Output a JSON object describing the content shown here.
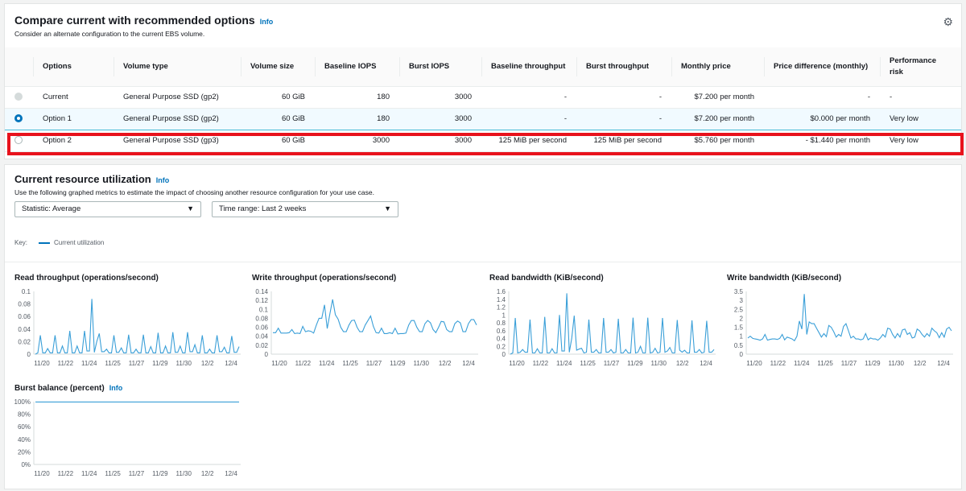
{
  "compare": {
    "title": "Compare current with recommended options",
    "info": "Info",
    "subtitle": "Consider an alternate configuration to the current EBS volume.",
    "settings_icon": "gear-icon",
    "columns": [
      "Options",
      "Volume type",
      "Volume size",
      "Baseline IOPS",
      "Burst IOPS",
      "Baseline throughput",
      "Burst throughput",
      "Monthly price",
      "Price difference (monthly)",
      "Performance risk"
    ],
    "rows": [
      {
        "state": "disabled",
        "option": "Current",
        "volume_type": "General Purpose SSD (gp2)",
        "volume_size": "60 GiB",
        "baseline_iops": "180",
        "burst_iops": "3000",
        "baseline_throughput": "-",
        "burst_throughput": "-",
        "monthly_price": "$7.200 per month",
        "price_difference": "-",
        "performance_risk": "-"
      },
      {
        "state": "selected",
        "option": "Option 1",
        "volume_type": "General Purpose SSD (gp2)",
        "volume_size": "60 GiB",
        "baseline_iops": "180",
        "burst_iops": "3000",
        "baseline_throughput": "-",
        "burst_throughput": "-",
        "monthly_price": "$7.200 per month",
        "price_difference": "$0.000 per month",
        "performance_risk": "Very low"
      },
      {
        "state": "unselected",
        "option": "Option 2",
        "volume_type": "General Purpose SSD (gp3)",
        "volume_size": "60 GiB",
        "baseline_iops": "3000",
        "burst_iops": "3000",
        "baseline_throughput": "125 MiB per second",
        "burst_throughput": "125 MiB per second",
        "monthly_price": "$5.760 per month",
        "price_difference": "- $1.440 per month",
        "performance_risk": "Very low"
      }
    ],
    "highlight_color": "#e8121c"
  },
  "utilization": {
    "title": "Current resource utilization",
    "info": "Info",
    "subtitle": "Use the following graphed metrics to estimate the impact of choosing another resource configuration for your use case.",
    "statistic": "Statistic: Average",
    "time_range": "Time range: Last 2 weeks",
    "key_label": "Key:",
    "legend": "Current utilization",
    "line_color": "#0073bb"
  },
  "chart_data": [
    {
      "type": "line",
      "title": "Read throughput (operations/second)",
      "ylim": [
        0,
        0.1
      ],
      "yticks": [
        "0",
        "0.02",
        "0.04",
        "0.06",
        "0.08",
        "0.1"
      ],
      "xticks": [
        "11/20",
        "11/22",
        "11/24",
        "11/25",
        "11/27",
        "11/29",
        "11/30",
        "12/2",
        "12/4"
      ],
      "series": [
        {
          "values": [
            0,
            0.002,
            0.03,
            0.002,
            0.002,
            0.009,
            0.002,
            0.002,
            0.03,
            0.002,
            0.002,
            0.013,
            0.002,
            0.002,
            0.037,
            0.002,
            0.002,
            0.013,
            0.002,
            0.002,
            0.037,
            0.005,
            0.005,
            0.088,
            0.003,
            0.02,
            0.033,
            0.004,
            0.004,
            0.008,
            0.002,
            0.002,
            0.03,
            0.003,
            0.003,
            0.01,
            0.002,
            0.002,
            0.031,
            0.002,
            0.002,
            0.008,
            0.002,
            0.002,
            0.031,
            0.002,
            0.002,
            0.012,
            0.002,
            0.002,
            0.034,
            0.002,
            0.002,
            0.013,
            0.002,
            0.002,
            0.035,
            0.003,
            0.003,
            0.013,
            0.002,
            0.002,
            0.035,
            0.004,
            0.004,
            0.015,
            0.002,
            0.002,
            0.03,
            0.002,
            0.002,
            0.008,
            0.002,
            0.002,
            0.03,
            0.004,
            0.004,
            0.011,
            0.002,
            0.002,
            0.029,
            0.003,
            0.003,
            0.012
          ]
        }
      ]
    },
    {
      "type": "line",
      "title": "Write throughput (operations/second)",
      "ylim": [
        0,
        0.14
      ],
      "yticks": [
        "0",
        "0.02",
        "0.04",
        "0.06",
        "0.08",
        "0.1",
        "0.12",
        "0.14"
      ],
      "xticks": [
        "11/20",
        "11/22",
        "11/24",
        "11/25",
        "11/27",
        "11/29",
        "11/30",
        "12/2",
        "12/4"
      ],
      "series": [
        {
          "values": [
            0.048,
            0.048,
            0.058,
            0.047,
            0.047,
            0.047,
            0.048,
            0.055,
            0.046,
            0.047,
            0.046,
            0.062,
            0.05,
            0.052,
            0.051,
            0.047,
            0.065,
            0.08,
            0.08,
            0.11,
            0.057,
            0.09,
            0.122,
            0.088,
            0.078,
            0.06,
            0.05,
            0.05,
            0.065,
            0.075,
            0.076,
            0.06,
            0.05,
            0.05,
            0.065,
            0.075,
            0.085,
            0.062,
            0.048,
            0.047,
            0.058,
            0.046,
            0.046,
            0.048,
            0.046,
            0.058,
            0.045,
            0.046,
            0.046,
            0.047,
            0.065,
            0.075,
            0.075,
            0.06,
            0.05,
            0.05,
            0.068,
            0.075,
            0.07,
            0.055,
            0.048,
            0.06,
            0.073,
            0.072,
            0.055,
            0.05,
            0.05,
            0.068,
            0.074,
            0.07,
            0.05,
            0.05,
            0.068,
            0.077,
            0.077,
            0.065
          ]
        }
      ]
    },
    {
      "type": "line",
      "title": "Read bandwidth (KiB/second)",
      "ylim": [
        0,
        1.6
      ],
      "yticks": [
        "0",
        "0.2",
        "0.4",
        "0.6",
        "0.8",
        "1",
        "1.2",
        "1.4",
        "1.6"
      ],
      "xticks": [
        "11/20",
        "11/22",
        "11/24",
        "11/25",
        "11/27",
        "11/29",
        "11/30",
        "12/2",
        "12/4"
      ],
      "series": [
        {
          "values": [
            0,
            0.03,
            0.92,
            0.03,
            0.05,
            0.12,
            0.05,
            0.05,
            0.88,
            0.03,
            0.03,
            0.14,
            0.03,
            0.03,
            0.95,
            0.03,
            0.03,
            0.14,
            0.03,
            0.03,
            1.0,
            0.08,
            0.08,
            1.55,
            0.05,
            0.4,
            0.98,
            0.1,
            0.13,
            0.15,
            0.03,
            0.05,
            0.88,
            0.05,
            0.05,
            0.12,
            0.03,
            0.03,
            0.92,
            0.05,
            0.05,
            0.12,
            0.03,
            0.05,
            0.9,
            0.03,
            0.03,
            0.12,
            0.03,
            0.03,
            0.93,
            0.03,
            0.05,
            0.2,
            0.03,
            0.03,
            0.93,
            0.03,
            0.05,
            0.15,
            0.03,
            0.05,
            0.92,
            0.05,
            0.08,
            0.17,
            0.03,
            0.03,
            0.87,
            0.1,
            0.05,
            0.1,
            0.03,
            0.03,
            0.86,
            0.05,
            0.05,
            0.12,
            0.03,
            0.05,
            0.85,
            0.05,
            0.05,
            0.12
          ]
        }
      ]
    },
    {
      "type": "line",
      "title": "Write bandwidth (KiB/second)",
      "ylim": [
        0,
        3.5
      ],
      "yticks": [
        "0",
        "0.5",
        "1",
        "1.5",
        "2",
        "2.5",
        "3",
        "3.5"
      ],
      "xticks": [
        "11/20",
        "11/22",
        "11/24",
        "11/25",
        "11/27",
        "11/29",
        "11/30",
        "12/2",
        "12/4"
      ],
      "series": [
        {
          "values": [
            0.9,
            1.0,
            0.88,
            0.85,
            0.82,
            0.78,
            0.85,
            1.1,
            0.78,
            0.82,
            0.85,
            0.85,
            0.82,
            0.88,
            1.1,
            0.8,
            0.95,
            0.9,
            0.85,
            0.75,
            1.0,
            1.85,
            1.4,
            3.35,
            1.1,
            1.8,
            1.7,
            1.7,
            1.45,
            1.2,
            0.95,
            1.15,
            0.98,
            1.6,
            1.5,
            1.25,
            0.95,
            1.1,
            1.0,
            1.55,
            1.7,
            1.3,
            0.9,
            1.0,
            0.85,
            0.85,
            0.8,
            0.85,
            1.15,
            0.8,
            0.9,
            0.85,
            0.85,
            0.78,
            0.9,
            1.1,
            0.95,
            1.45,
            1.4,
            1.1,
            0.9,
            1.15,
            0.95,
            1.35,
            1.4,
            1.1,
            1.2,
            0.9,
            0.95,
            1.4,
            1.3,
            1.1,
            0.95,
            1.15,
            1.0,
            1.45,
            1.3,
            1.2,
            0.92,
            1.2,
            0.95,
            1.4,
            1.5,
            1.3
          ]
        }
      ]
    },
    {
      "type": "line",
      "title": "Burst balance (percent)",
      "info": "Info",
      "ylim": [
        0,
        100
      ],
      "yticks": [
        "0%",
        "20%",
        "40%",
        "60%",
        "80%",
        "100%"
      ],
      "xticks": [
        "11/20",
        "11/22",
        "11/24",
        "11/25",
        "11/27",
        "11/29",
        "11/30",
        "12/2",
        "12/4"
      ],
      "series": [
        {
          "values": [
            99.5,
            99.5,
            99.5,
            99.5,
            99.5,
            99.5,
            99.5,
            99.5,
            99.5,
            99.5,
            99.5,
            99.5,
            99.5,
            99.5,
            99.5,
            99.5
          ]
        }
      ]
    }
  ]
}
